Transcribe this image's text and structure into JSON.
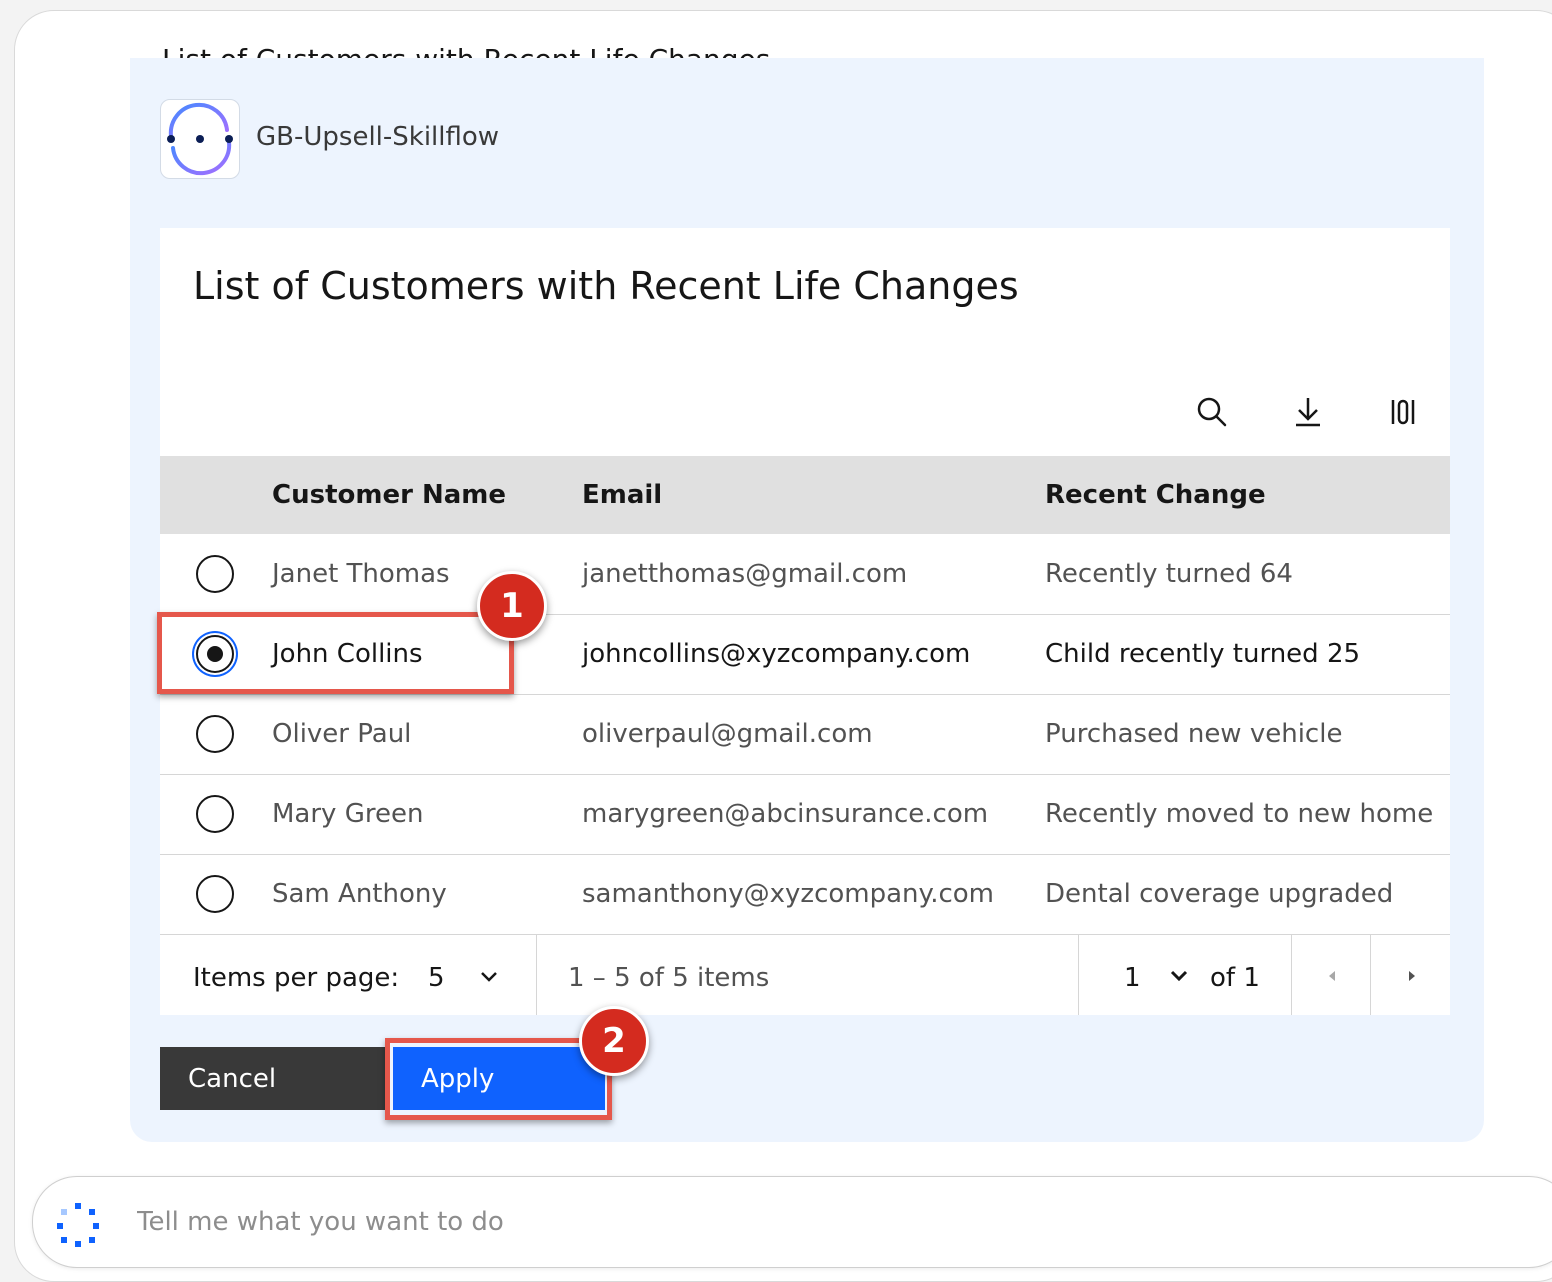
{
  "skill": {
    "truncated_title": "List of Customers with Recent Life Changes",
    "name": "GB-Upsell-Skillflow"
  },
  "table": {
    "title": "List of Customers with Recent Life Changes",
    "toolbar": [
      "search-icon",
      "download-icon",
      "column-settings-icon"
    ],
    "columns": [
      "Customer Name",
      "Email",
      "Recent Change"
    ],
    "rows": [
      {
        "name": "Janet Thomas",
        "email": "janetthomas@gmail.com",
        "change": "Recently turned 64",
        "selected": false
      },
      {
        "name": "John Collins",
        "email": "johncollins@xyzcompany.com",
        "change": "Child recently turned 25",
        "selected": true
      },
      {
        "name": "Oliver Paul",
        "email": "oliverpaul@gmail.com",
        "change": "Purchased new vehicle",
        "selected": false
      },
      {
        "name": "Mary Green",
        "email": "marygreen@abcinsurance.com",
        "change": "Recently moved to new home",
        "selected": false
      },
      {
        "name": "Sam Anthony",
        "email": "samanthony@xyzcompany.com",
        "change": "Dental coverage upgraded",
        "selected": false
      }
    ],
    "pagination": {
      "items_per_page_label": "Items per page:",
      "items_per_page_value": "5",
      "range_text": "1 – 5 of 5 items",
      "page_value": "1",
      "of_pages": "of 1"
    }
  },
  "actions": {
    "cancel_label": "Cancel",
    "apply_label": "Apply"
  },
  "annotations": {
    "step1": "1",
    "step2": "2",
    "highlight_color": "#e5574b",
    "badge_color": "#d42b1f"
  },
  "input": {
    "placeholder": "Tell me what you want to do"
  },
  "colors": {
    "primary_button": "#0f62fe",
    "secondary_button": "#393939",
    "card_background": "#edf4fe",
    "header_background": "#e0e0e0"
  }
}
